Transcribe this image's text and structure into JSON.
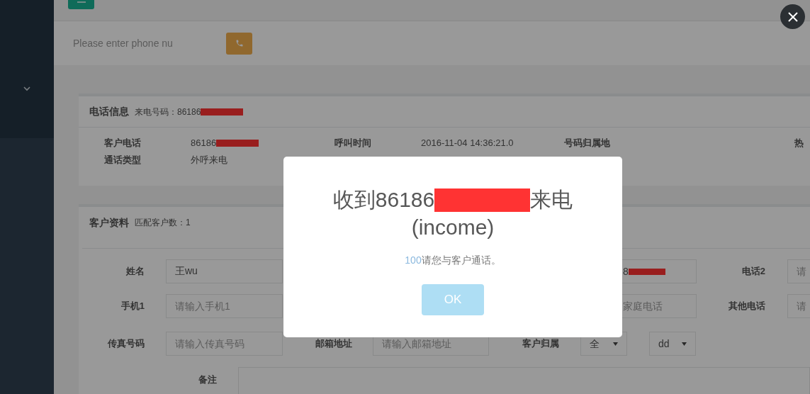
{
  "toolbar": {
    "phone_input": {
      "placeholder": "Please enter phone nu"
    }
  },
  "call_info": {
    "title": "电话信息",
    "caller_label": "来电号码：86186",
    "caller_redacted": true,
    "rows": [
      [
        {
          "label": "客户电话",
          "value": "86186",
          "redacted": true
        },
        {
          "label": "呼叫时间",
          "value": "2016-11-04 14:36:21.0"
        },
        {
          "label": "号码归属地"
        },
        {
          "label": "热"
        }
      ],
      [
        {
          "label": "通话类型",
          "value": "外呼来电"
        }
      ]
    ]
  },
  "customer": {
    "title": "客户资料",
    "match_count": "匹配客户数：1",
    "rows": [
      [
        {
          "label": "姓名",
          "field": {
            "kind": "input",
            "value": "王wu"
          }
        },
        null,
        {
          "field": {
            "kind": "wide",
            "value": "8",
            "redacted": true
          }
        },
        {
          "label": "电话2",
          "field": {
            "kind": "input",
            "placeholder": "请"
          }
        }
      ],
      [
        {
          "label": "手机1",
          "field": {
            "kind": "input",
            "placeholder": "请输入手机1"
          }
        },
        null,
        {
          "field": {
            "kind": "wide",
            "placeholder": "家庭电话"
          }
        },
        {
          "label": "其他电话",
          "field": {
            "kind": "input",
            "placeholder": "请"
          }
        }
      ],
      [
        {
          "label": "传真号码",
          "field": {
            "kind": "input",
            "placeholder": "请输入传真号码"
          }
        },
        {
          "label": "邮箱地址",
          "field": {
            "kind": "input",
            "placeholder": "请输入邮箱地址"
          }
        },
        {
          "label": "客户归属",
          "field": {
            "kind": "selects",
            "values": [
              "全",
              "dd"
            ]
          }
        }
      ]
    ],
    "remark_label": "备注"
  },
  "dialog": {
    "title_prefix": "收到86186",
    "title_redacted": true,
    "title_suffix": "来电",
    "title_line2": "(income)",
    "agent": "100",
    "message": "请您与客户通话。",
    "button": "OK"
  }
}
